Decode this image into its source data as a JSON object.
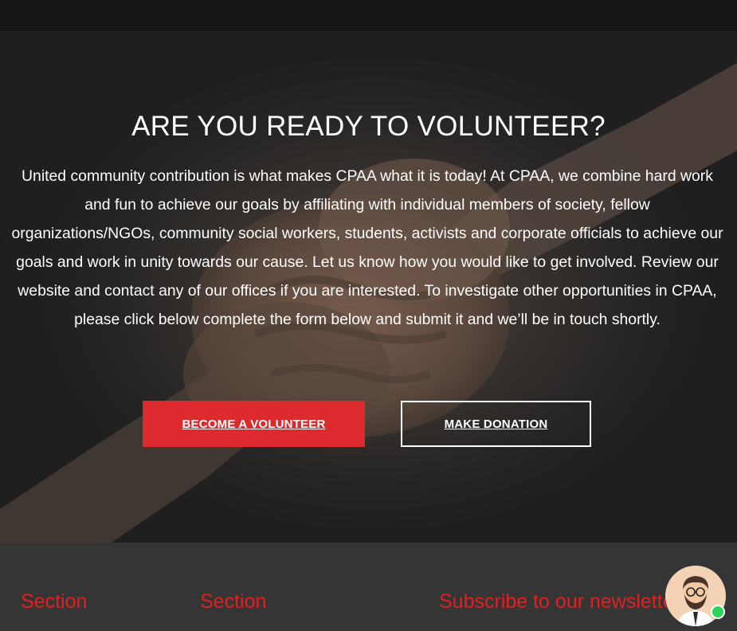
{
  "hero": {
    "title": "ARE YOU READY TO VOLUNTEER?",
    "text": "United community contribution is what makes CPAA what it is today! At CPAA, we combine hard work and fun to achieve our goals by affiliating with individual members of society, fellow organizations/NGOs, community social workers, students, activists and corporate officials to achieve our goals and work in unity towards our cause. Let us know how you would like to get involved. Review our website and contact any of our offices if you are interested. To investigate other opportunities in CPAA, please click below complete the form below and submit it and we’ll be in touch shortly.",
    "primary_button": "BECOME A VOLUNTEER",
    "secondary_button": "MAKE DONATION"
  },
  "footer": {
    "col1_title": "Section",
    "col2_title": "Section",
    "newsletter_title": "Subscribe to our newsletter"
  },
  "colors": {
    "accent": "#dc2a2e",
    "footer_heading": "#e3201f",
    "online": "#2bd45a"
  },
  "icons": {
    "chat": "support-agent-avatar-icon"
  }
}
